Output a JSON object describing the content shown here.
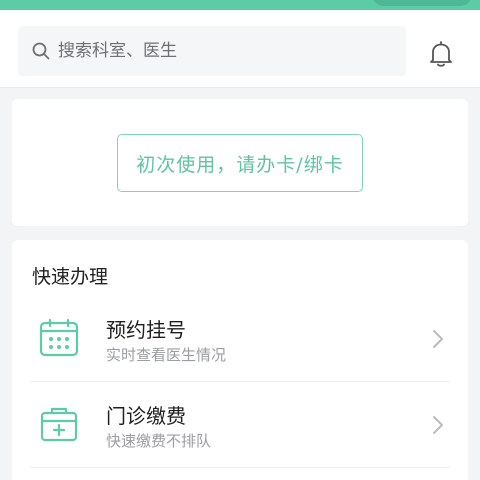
{
  "search": {
    "placeholder": "搜索科室、医生"
  },
  "bind_card": {
    "button_label": "初次使用，请办卡/绑卡"
  },
  "quick": {
    "title": "快速办理",
    "items": [
      {
        "title": "预约挂号",
        "subtitle": "实时查看医生情况",
        "icon": "calendar-icon"
      },
      {
        "title": "门诊缴费",
        "subtitle": "快速缴费不排队",
        "icon": "medical-kit-icon"
      }
    ]
  },
  "colors": {
    "accent": "#5ecba7",
    "text_primary": "#1f1f1f",
    "text_secondary": "#9a9da3"
  }
}
